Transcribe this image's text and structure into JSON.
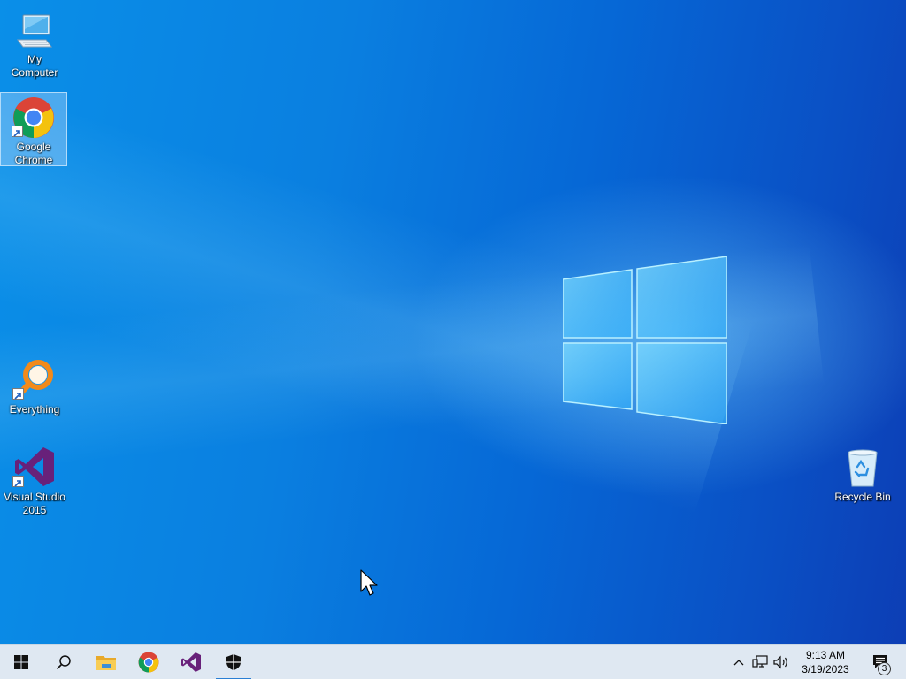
{
  "desktop": {
    "icons": [
      {
        "label": "My Computer",
        "icon": "monitor-icon",
        "selected": false
      },
      {
        "label": "Google\nChrome",
        "icon": "chrome-icon",
        "selected": true
      },
      {
        "label": "Everything",
        "icon": "everything-search-icon",
        "selected": false
      },
      {
        "label": "Visual Studio\n2015",
        "icon": "visual-studio-icon",
        "selected": false
      },
      {
        "label": "Recycle Bin",
        "icon": "recycle-bin-icon",
        "selected": false
      }
    ]
  },
  "taskbar": {
    "buttons": [
      {
        "icon": "windows-start-icon"
      },
      {
        "icon": "search-icon"
      },
      {
        "icon": "file-explorer-icon"
      },
      {
        "icon": "chrome-icon"
      },
      {
        "icon": "visual-studio-icon"
      },
      {
        "icon": "security-shield-icon",
        "active": true
      }
    ],
    "tray": {
      "icons": [
        "chevron-up-icon",
        "network-icon",
        "volume-icon"
      ],
      "time": "9:13 AM",
      "date": "3/19/2023",
      "notification_count": "3"
    }
  },
  "colors": {
    "taskbar_bg": "#dfe8f2",
    "desktop_blue": "#0a7fe0",
    "active_indicator": "#2a7fd4"
  }
}
